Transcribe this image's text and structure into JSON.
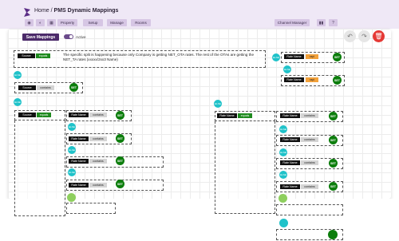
{
  "header": {
    "home": "Home",
    "separator": "/",
    "title": "PMS Dynamic Mappings"
  },
  "nav": {
    "tabs": [
      "Property",
      "Setup",
      "Manage",
      "Rooms"
    ],
    "channel_manager": "Channel Manager"
  },
  "toolbar": {
    "save_label": "Save Mappings",
    "active_label": "Active"
  },
  "labels": {
    "source": "Source",
    "equals": "equals",
    "contains": "contains",
    "rate_name": "Rate Name",
    "set": "SET",
    "else": "ELSE",
    "rapi": "rapi"
  },
  "message": "The specific split is happening because only Company is getting NET_OTA rates. The rest of the OTAs are getting the NET_TA rates (xxxxx/2xx3 Name)",
  "colors": {
    "accent": "#4b2a69",
    "set_green": "#0c7d0c",
    "else_teal": "#1fc2c9",
    "delete_red": "#e53935"
  }
}
